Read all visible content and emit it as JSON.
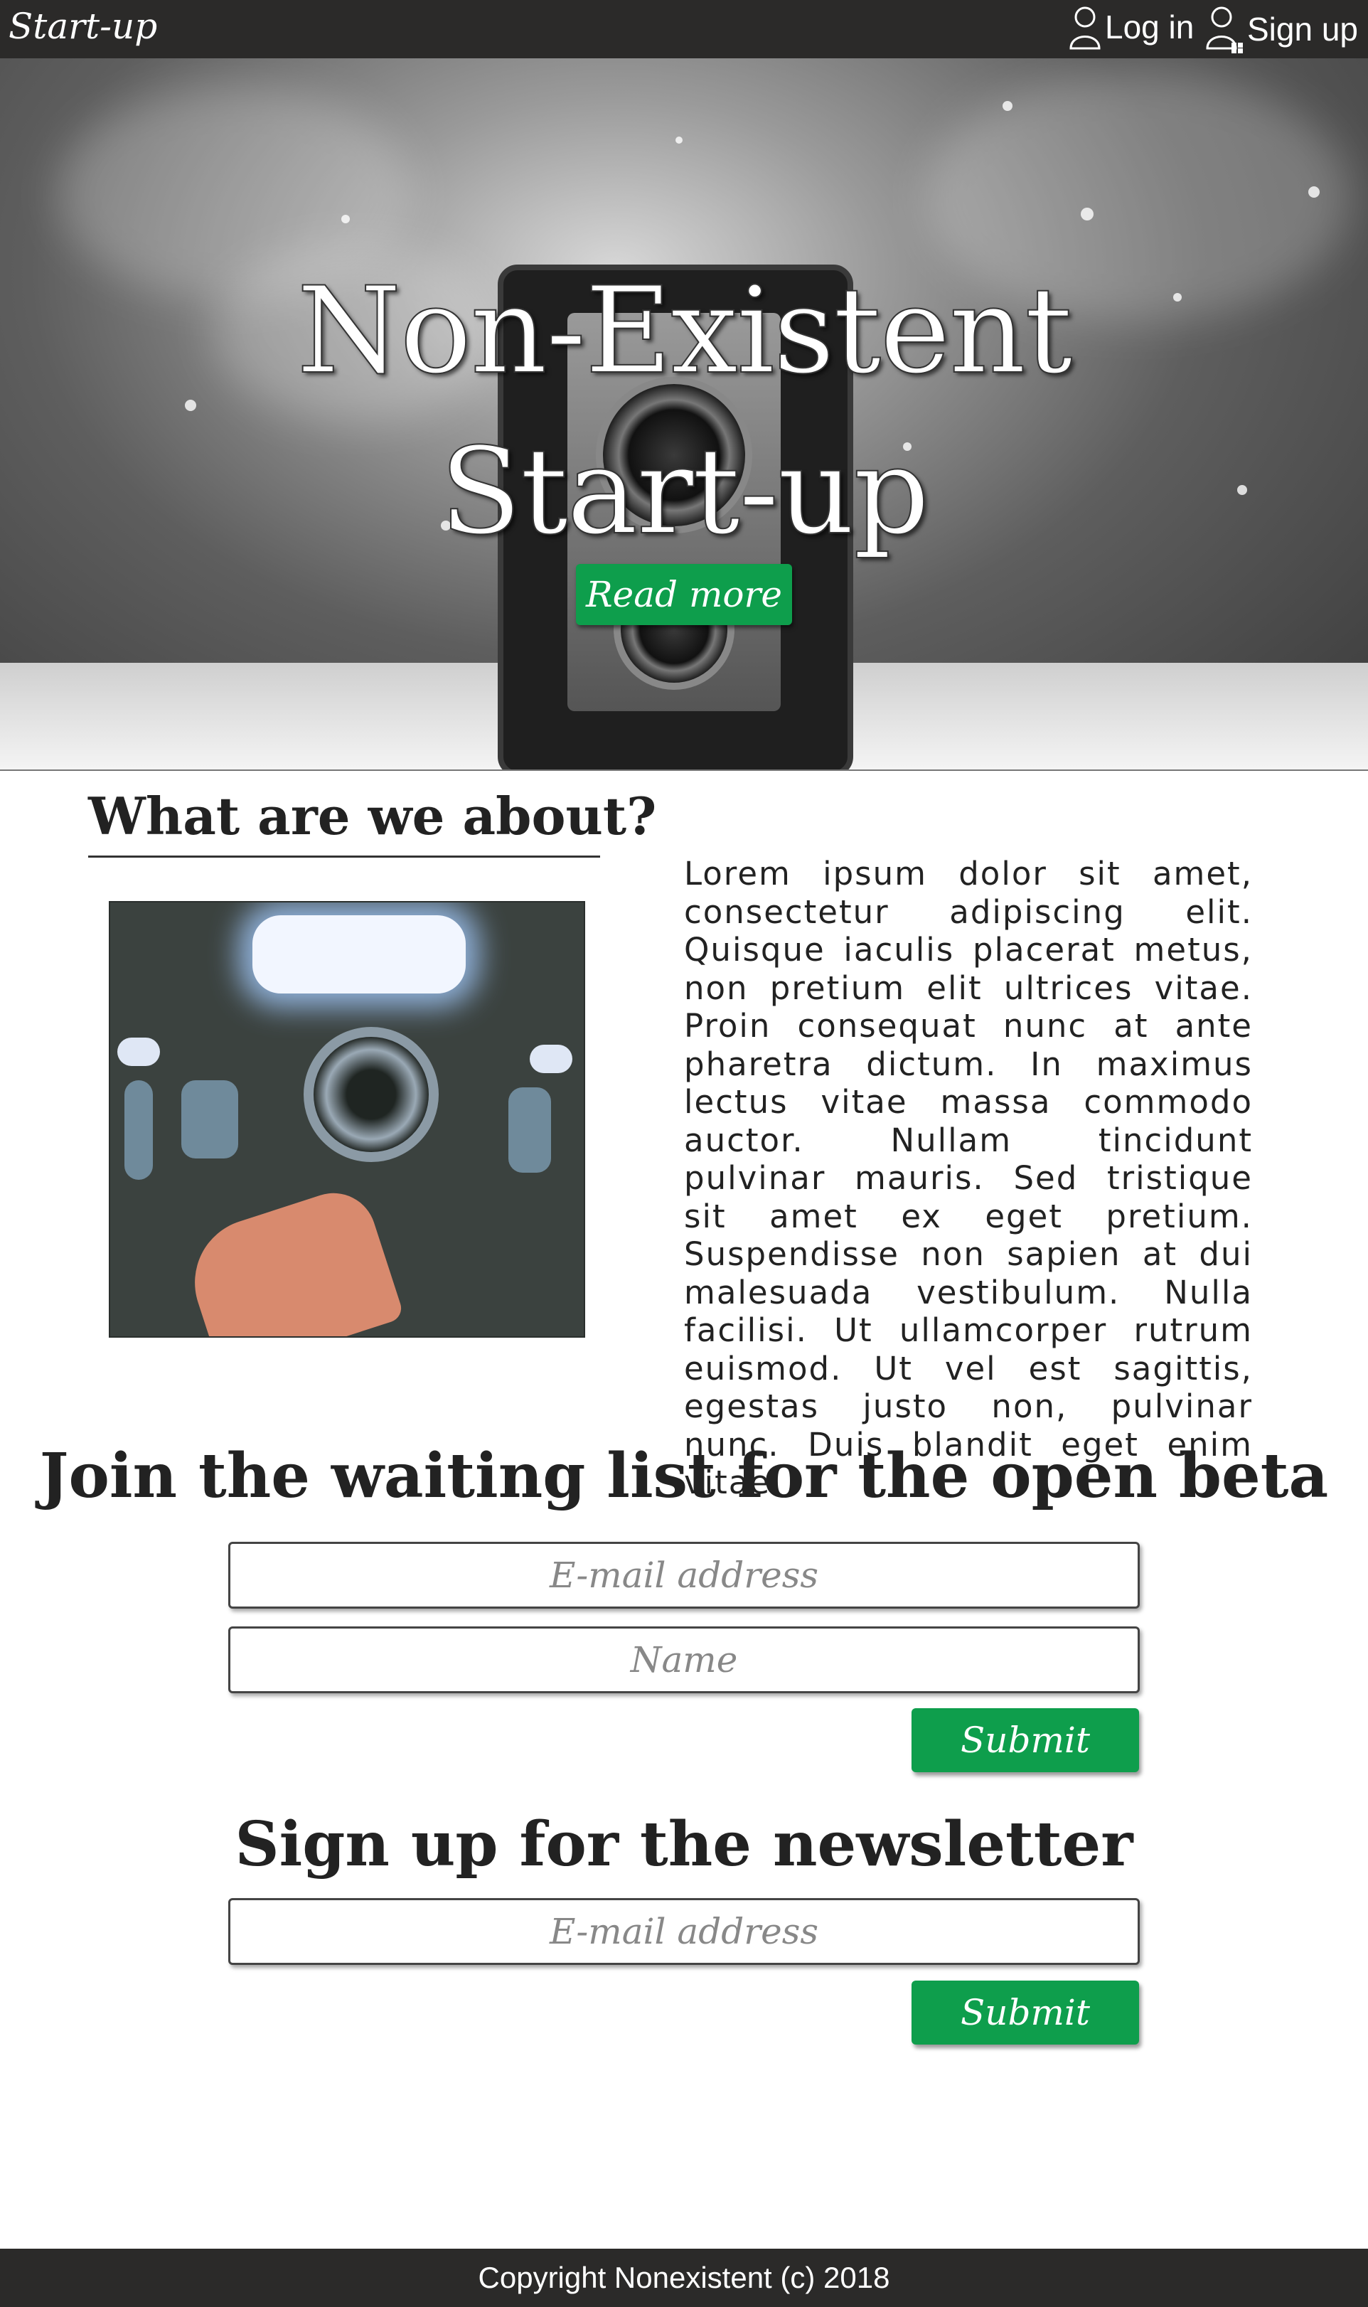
{
  "header": {
    "brand": "Start-up",
    "login_label": "Log in",
    "signup_label": "Sign up"
  },
  "hero": {
    "title_line1": "Non-Existent",
    "title_line2": "Start-up",
    "cta_label": "Read more"
  },
  "about": {
    "heading": "What are we about?",
    "body": "Lorem ipsum dolor sit amet, consectetur adipiscing elit. Quisque iaculis placerat metus, non pretium elit ultrices vitae. Proin consequat nunc at ante pharetra dictum. In maximus lectus vitae massa commodo auctor. Nullam tincidunt pulvinar mauris. Sed tristique sit amet ex eget pretium. Suspendisse non sapien at dui malesuada vestibulum. Nulla facilisi. Ut ullamcorper rutrum euismod. Ut vel est sagittis, egestas justo non, pulvinar nunc. Duis blandit eget enim vitae."
  },
  "waitlist": {
    "heading": "Join the waiting list for the open beta",
    "email_placeholder": "E-mail address",
    "name_placeholder": "Name",
    "submit_label": "Submit"
  },
  "newsletter": {
    "heading": "Sign up for the newsletter",
    "email_placeholder": "E-mail address",
    "submit_label": "Submit"
  },
  "footer": {
    "copyright": "Copyright Nonexistent (c) 2018"
  },
  "colors": {
    "bar": "#2b2a29",
    "accent_green": "#0e9e4c"
  }
}
